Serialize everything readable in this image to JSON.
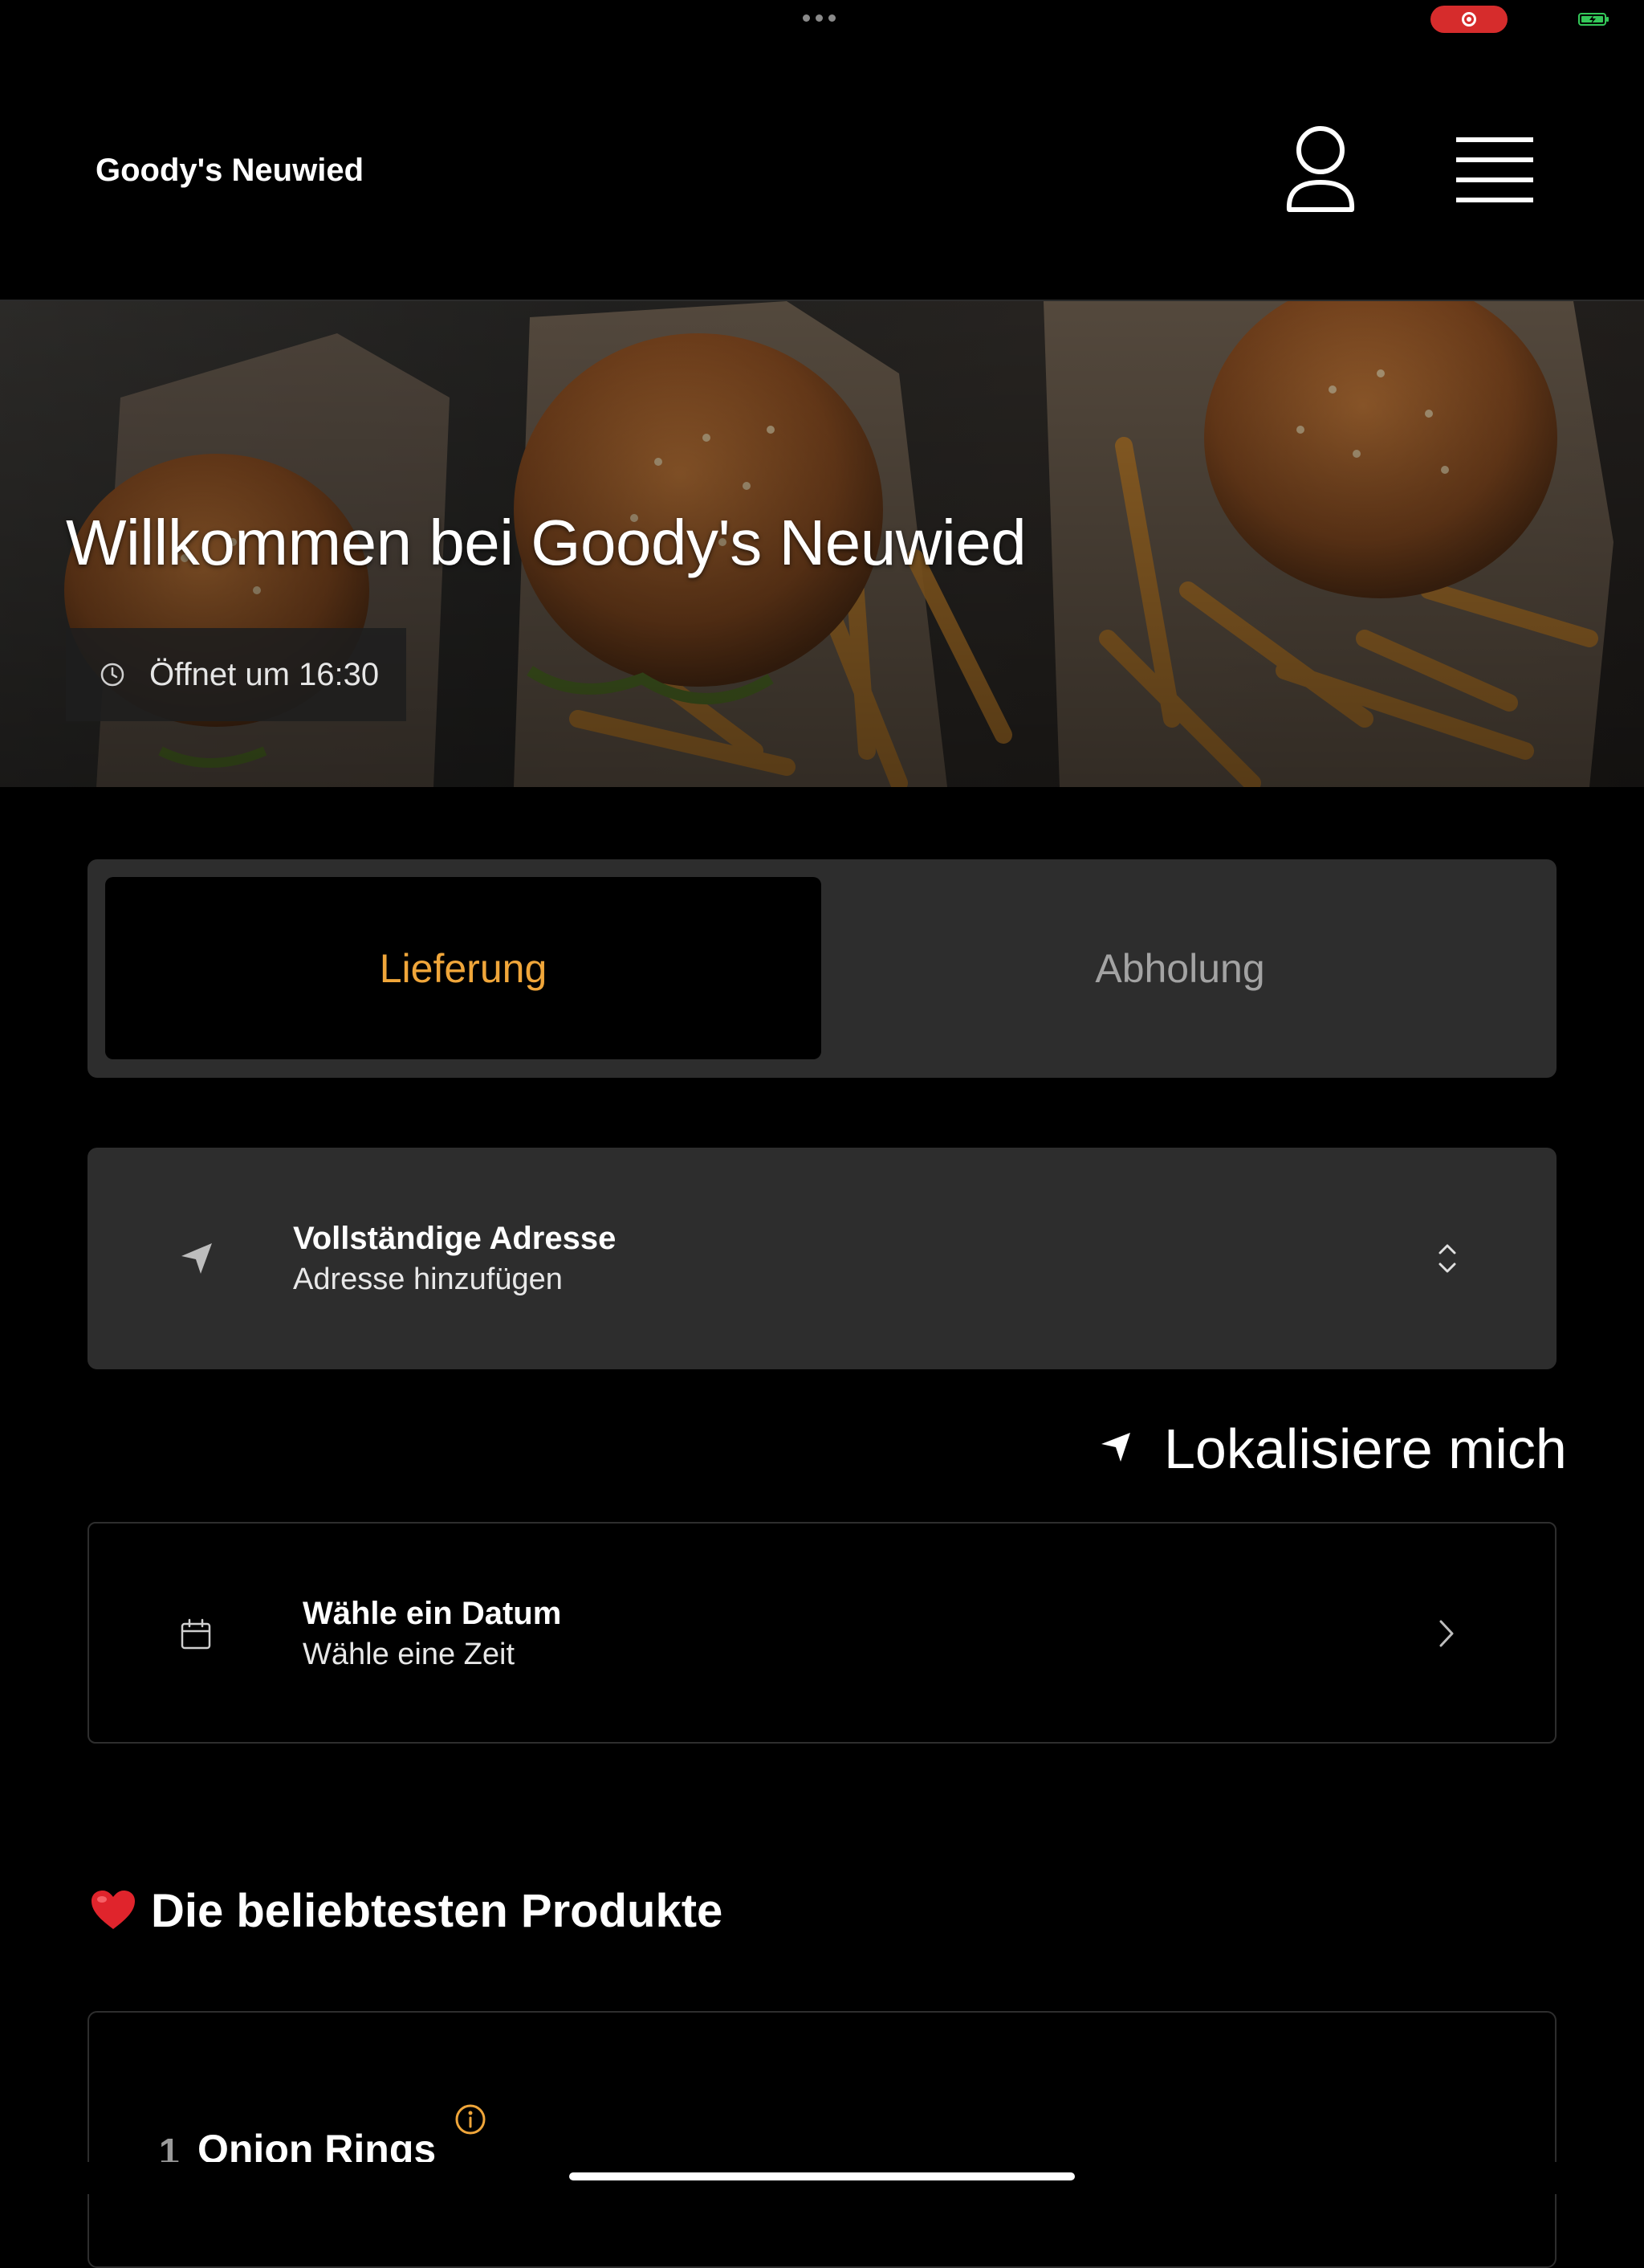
{
  "status_bar": {
    "record_icon": "record-icon",
    "battery_icon": "battery-charging-icon"
  },
  "header": {
    "brand": "Goody's Neuwied",
    "user_icon": "user-icon",
    "menu_icon": "hamburger-menu-icon"
  },
  "hero": {
    "title": "Willkommen bei Goody's Neuwied",
    "opening": "Öffnet um 16:30",
    "clock_icon": "clock-icon"
  },
  "order_mode": {
    "options": [
      "Lieferung",
      "Abholung"
    ],
    "selected": "Lieferung",
    "accent": "#f0a63a"
  },
  "address": {
    "title": "Vollständige Adresse",
    "subtitle": "Adresse hinzufügen"
  },
  "locate": {
    "label": "Lokalisiere mich"
  },
  "schedule": {
    "title": "Wähle ein Datum",
    "subtitle": "Wähle eine Zeit"
  },
  "popular": {
    "heading": "Die beliebtesten Produkte",
    "products": [
      {
        "rank": "1",
        "name": "Onion Rings"
      }
    ]
  },
  "colors": {
    "background": "#000000",
    "card": "#2d2d2d",
    "accent": "#f0a63a",
    "muted": "#a3a3a3"
  }
}
